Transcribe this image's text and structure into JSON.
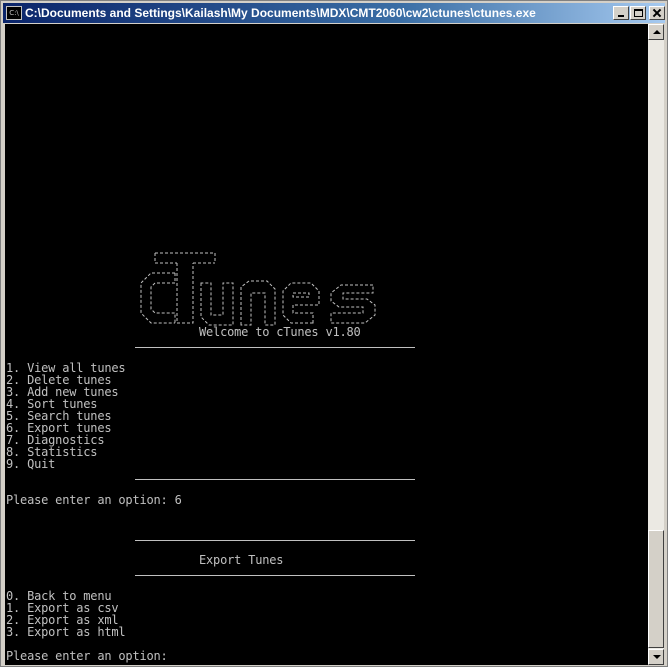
{
  "window": {
    "title": "C:\\Documents and Settings\\Kailash\\My Documents\\MDX\\CMT2060\\cw2\\ctunes\\ctunes.exe",
    "icon_label": "C:\\"
  },
  "logo": {
    "text": "cTunes",
    "color": "#c0c0c0"
  },
  "console": {
    "welcome": "Welcome to cTunes v1.80",
    "main_menu": [
      "1. View all tunes",
      "2. Delete tunes",
      "3. Add new tunes",
      "4. Sort tunes",
      "5. Search tunes",
      "6. Export tunes",
      "7. Diagnostics",
      "8. Statistics",
      "9. Quit"
    ],
    "prompt1": "Please enter an option: 6",
    "export_heading": "Export Tunes",
    "export_menu": [
      "0. Back to menu",
      "1. Export as csv",
      "2. Export as xml",
      "3. Export as html"
    ],
    "prompt2": "Please enter an option:"
  },
  "colors": {
    "console_bg": "#000000",
    "console_fg": "#c0c0c0",
    "titlebar": "#0a246a"
  }
}
